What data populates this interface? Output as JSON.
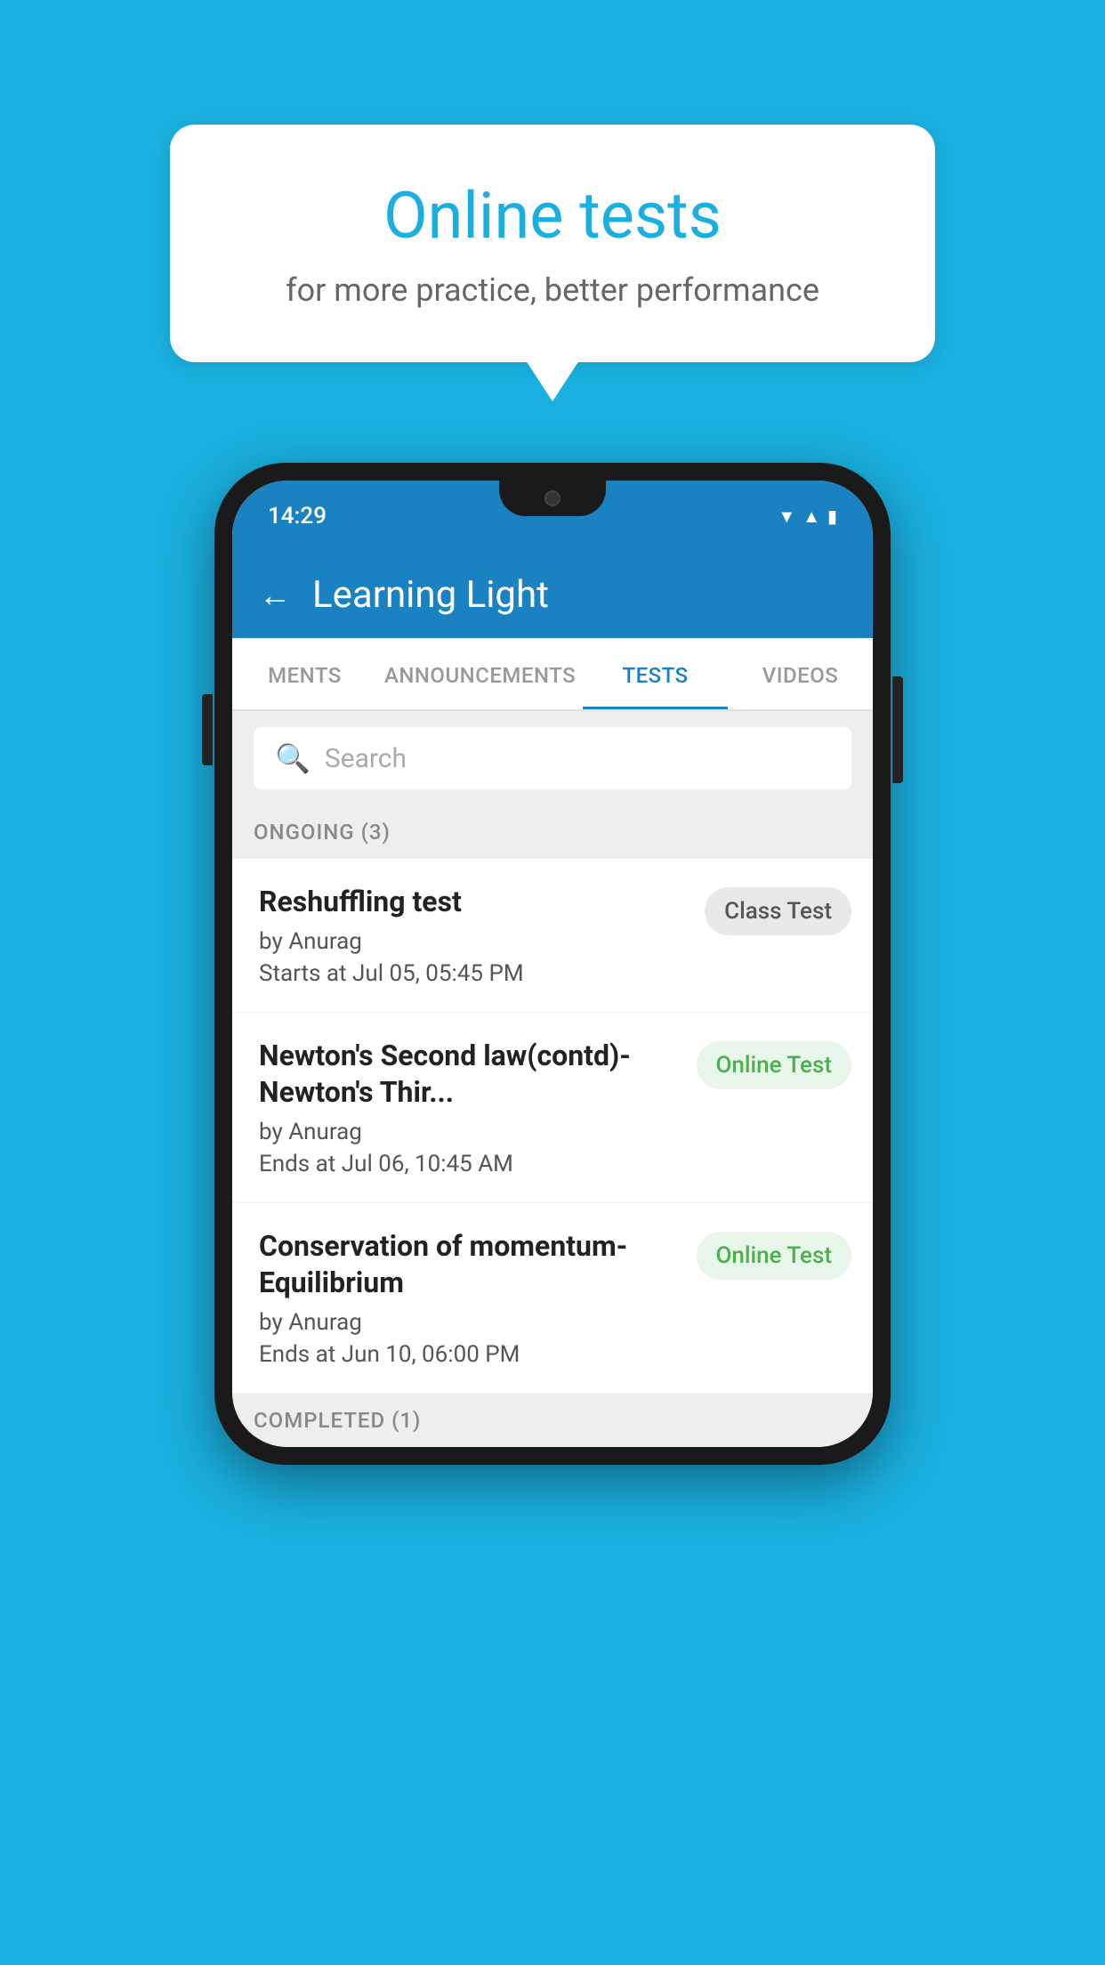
{
  "background": {
    "color": "#1AAFDE"
  },
  "bubble": {
    "title": "Online tests",
    "subtitle": "for more practice, better performance"
  },
  "phone": {
    "statusBar": {
      "time": "14:29",
      "icons": [
        "wifi",
        "signal",
        "battery"
      ]
    },
    "header": {
      "back_label": "←",
      "title": "Learning Light"
    },
    "tabs": [
      {
        "label": "MENTS",
        "active": false
      },
      {
        "label": "ANNOUNCEMENTS",
        "active": false
      },
      {
        "label": "TESTS",
        "active": true
      },
      {
        "label": "VIDEOS",
        "active": false
      }
    ],
    "search": {
      "placeholder": "Search"
    },
    "sections": [
      {
        "label": "ONGOING (3)",
        "tests": [
          {
            "name": "Reshuffling test",
            "by": "by Anurag",
            "date_label": "Starts at",
            "date": "Jul 05, 05:45 PM",
            "badge": "Class Test",
            "badge_type": "class"
          },
          {
            "name": "Newton's Second law(contd)-Newton's Thir...",
            "by": "by Anurag",
            "date_label": "Ends at",
            "date": "Jul 06, 10:45 AM",
            "badge": "Online Test",
            "badge_type": "online"
          },
          {
            "name": "Conservation of momentum-Equilibrium",
            "by": "by Anurag",
            "date_label": "Ends at",
            "date": "Jun 10, 06:00 PM",
            "badge": "Online Test",
            "badge_type": "online"
          }
        ]
      },
      {
        "label": "COMPLETED (1)",
        "tests": []
      }
    ]
  }
}
